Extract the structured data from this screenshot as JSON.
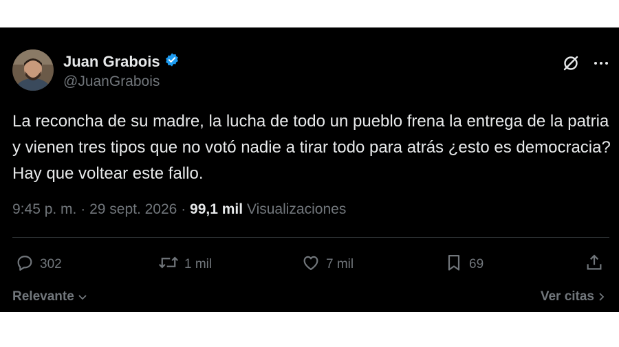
{
  "author": {
    "name": "Juan Grabois",
    "handle": "@JuanGrabois",
    "verified": true
  },
  "tweet": {
    "text": "La reconcha de su madre, la lucha de todo un pueblo frena la entrega de la patria y vienen tres tipos que no votó nadie a tirar todo para atrás ¿esto es democracia? Hay que voltear este fallo.",
    "time": "9:45 p. m.",
    "date": "29 sept. 2026",
    "separator": "·",
    "views_count": "99,1 mil",
    "views_label": "Visualizaciones"
  },
  "actions": {
    "replies": "302",
    "retweets": "1 mil",
    "likes": "7 mil",
    "bookmarks": "69"
  },
  "footer": {
    "sort_label": "Relevante",
    "quotes_label": "Ver citas"
  },
  "colors": {
    "background": "#000000",
    "text": "#e7e9ea",
    "muted": "#71767b",
    "verified": "#1d9bf0"
  }
}
